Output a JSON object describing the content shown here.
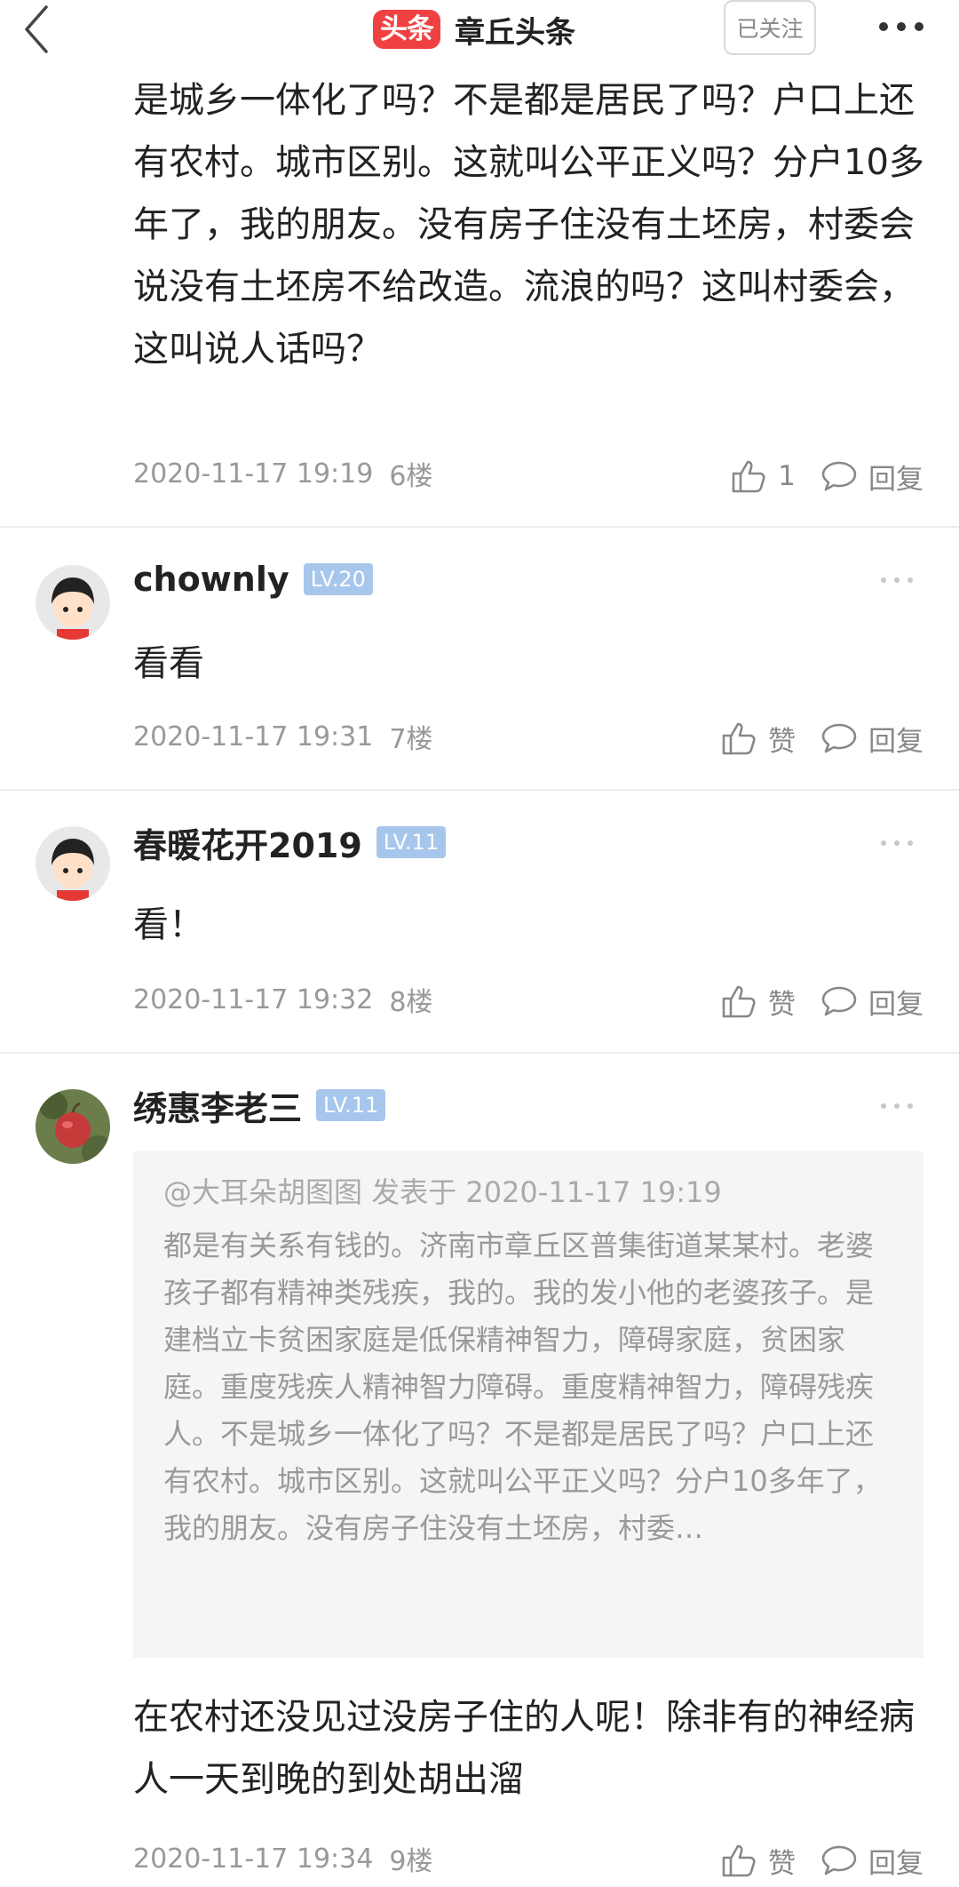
{
  "header": {
    "badge": "头条",
    "name": "章丘头条",
    "follow_label": "已关注"
  },
  "comments": [
    {
      "text": "人精神智力障碍。重度精神智力，障碍残疾人。不是城乡一体化了吗？不是都是居民了吗？户口上还有农村。城市区别。这就叫公平正义吗？分户10多年了，我的朋友。没有房子住没有土坯房，村委会说没有土坯房不给改造。流浪的吗？这叫村委会，这叫说人话吗？",
      "time": "2020-11-17 19:19",
      "floor": "6楼",
      "like_label": "1",
      "reply_label": "回复"
    },
    {
      "username": "chownly",
      "level": "LV.20",
      "text": "看看",
      "time": "2020-11-17 19:31",
      "floor": "7楼",
      "like_label": "赞",
      "reply_label": "回复"
    },
    {
      "username": "春暖花开2019",
      "level": "LV.11",
      "text": "看！",
      "time": "2020-11-17 19:32",
      "floor": "8楼",
      "like_label": "赞",
      "reply_label": "回复"
    },
    {
      "username": "绣惠李老三",
      "level": "LV.11",
      "quote_head": "@大耳朵胡图图 发表于 2020-11-17 19:19",
      "quote_text": "都是有关系有钱的。济南市章丘区普集街道某某村。老婆孩子都有精神类残疾，我的。我的发小他的老婆孩子。是建档立卡贫困家庭是低保精神智力，障碍家庭，贫困家庭。重度残疾人精神智力障碍。重度精神智力，障碍残疾人。不是城乡一体化了吗？不是都是居民了吗？户口上还有农村。城市区别。这就叫公平正义吗？分户10多年了，我的朋友。没有房子住没有土坯房，村委…",
      "text": "在农村还没见过没房子住的人呢！除非有的神经病人一天到晚的到处胡出溜",
      "time": "2020-11-17 19:34",
      "floor": "9楼",
      "like_label": "赞",
      "reply_label": "回复"
    }
  ],
  "icons": {
    "back": "chevron-left-icon",
    "more": "more-horizontal-icon",
    "like": "thumbs-up-icon",
    "reply": "speech-bubble-icon",
    "comment_more": "ellipsis-icon"
  },
  "colors": {
    "brand_red": "#f04142",
    "level_badge": "#a7c6ec",
    "quote_bg": "#f5f5f5",
    "meta_gray": "#999999"
  }
}
